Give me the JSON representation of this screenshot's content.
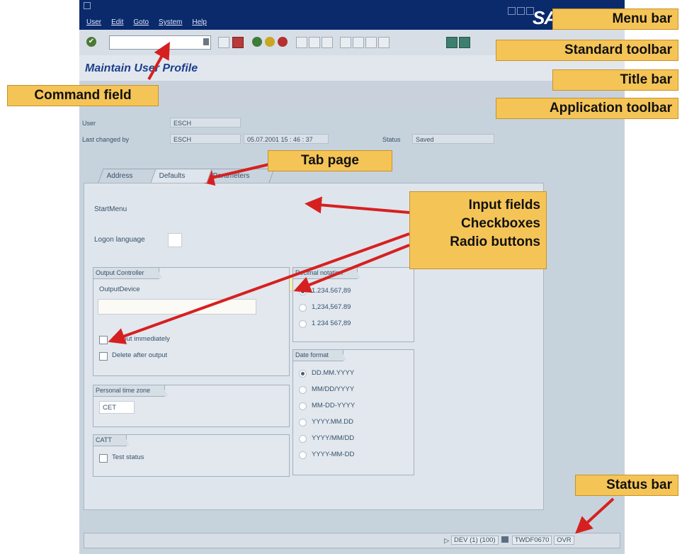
{
  "sap": {
    "menu": [
      "User",
      "Edit",
      "Goto",
      "System",
      "Help"
    ],
    "logo": "SA",
    "title": "Maintain User Profile",
    "header_fields": {
      "user_label": "User",
      "user_value": "ESCH",
      "changed_label": "Last changed by",
      "changed_value": "ESCH",
      "datetime": "05.07.2001 15 : 46 : 37",
      "status_label": "Status",
      "status_value": "Saved"
    },
    "tabs": [
      "Address",
      "Defaults",
      "Parameters"
    ],
    "defaults": {
      "start_menu_label": "StartMenu",
      "logon_language_label": "Logon language",
      "output_controller": {
        "title": "Output Controller",
        "device_label": "OutputDevice",
        "checkboxes": [
          "Output immediately",
          "Delete after output"
        ]
      },
      "personal_time_zone": {
        "title": "Personal time zone",
        "value": "CET"
      },
      "catt": {
        "title": "CATT",
        "checkbox": "Test status"
      },
      "decimal_notation": {
        "title": "Decimal notation",
        "options": [
          "1.234.567,89",
          "1,234,567.89",
          "1 234 567,89"
        ],
        "selected": 0
      },
      "date_format": {
        "title": "Date format",
        "options": [
          "DD.MM.YYYY",
          "MM/DD/YYYY",
          "MM-DD-YYYY",
          "YYYY.MM.DD",
          "YYYY/MM/DD",
          "YYYY-MM-DD"
        ],
        "selected": 0
      }
    },
    "statusbar": {
      "system": "DEV (1) (100)",
      "host": "TWDF0670",
      "mode": "OVR"
    }
  },
  "callouts": {
    "menu_bar": "Menu bar",
    "standard_toolbar": "Standard toolbar",
    "title_bar": "Title bar",
    "application_toolbar": "Application toolbar",
    "command_field": "Command field",
    "tab_page": "Tab page",
    "input_fields": "Input fields",
    "checkboxes": "Checkboxes",
    "radio_buttons": "Radio buttons",
    "status_bar": "Status bar"
  },
  "colors": {
    "menubar": "#0b2a6b",
    "callout": "#f5c457",
    "arrow": "#d62020",
    "title_text": "#1c3f8c"
  }
}
